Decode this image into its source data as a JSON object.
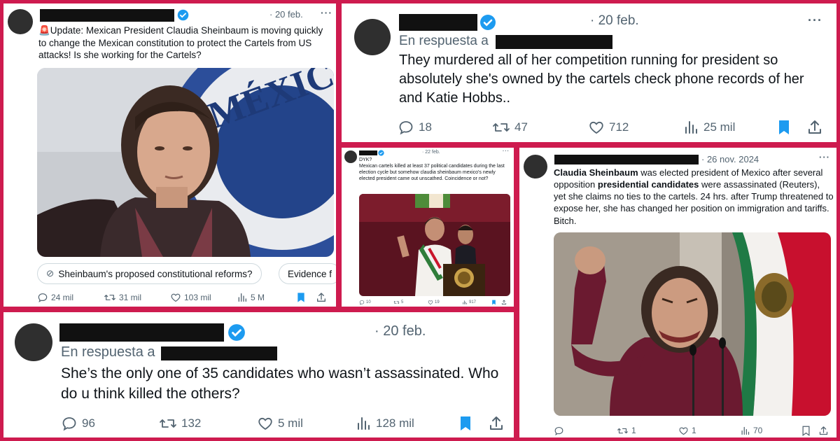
{
  "panel1": {
    "date": "· 20 feb.",
    "more": "···",
    "text": "🚨Update: Mexican President Claudia Sheinbaum is moving quickly to change the Mexican constitution to protect the Cartels from US attacks! Is she working for the Cartels?",
    "seal_text": "MÉXICO",
    "chip1": "Sheinbaum's proposed constitutional reforms?",
    "chip2": "Evidence f",
    "replies": "24 mil",
    "retweets": "31 mil",
    "likes": "103 mil",
    "views": "5 M"
  },
  "panel2": {
    "date": "· 20 feb.",
    "more": "···",
    "reply_label": "En respuesta a",
    "text": "They murdered all of her competition running for president so absolutely she's owned by the cartels check phone records of her and Katie Hobbs..",
    "replies": "18",
    "retweets": "47",
    "likes": "712",
    "views": "25 mil"
  },
  "panel3": {
    "date": "· 22 feb.",
    "more": "···",
    "text_line1": "DYK?",
    "text": "Mexican cartels killed at least 37 political candidates during the last election cycle but somehow claudia sheinbaum mexico's newly elected president came out unscathed. Coincidence or not?",
    "replies": "10",
    "retweets": "5",
    "likes": "19",
    "views": "917"
  },
  "panel4": {
    "date": "· 26 nov. 2024",
    "more": "···",
    "text_bold1": "Claudia Sheinbaum",
    "text_part1": " was elected president of Mexico after several opposition ",
    "text_bold2": "presidential candidates",
    "text_part2": " were assassinated (Reuters), yet she claims no ties to the cartels. 24 hrs. after Trump threatened to expose her, she has changed her position on immigration and tariffs. Bitch.",
    "replies": "",
    "retweets": "1",
    "likes": "1",
    "views": "70"
  },
  "panel5": {
    "date": "· 20 feb.",
    "more": "···",
    "reply_label": "En respuesta a",
    "text": "She’s the only one of 35 candidates who wasn’t assassinated. Who do u think killed the others?",
    "replies": "96",
    "retweets": "132",
    "likes": "5 mil",
    "views": "128 mil"
  },
  "colors": {
    "frame": "#ce1b4f",
    "verified": "#1d9bf0",
    "secondary_text": "#536471",
    "mexico_green": "#006847",
    "mexico_red": "#ce1126",
    "maroon_suit": "#6b1a30"
  }
}
